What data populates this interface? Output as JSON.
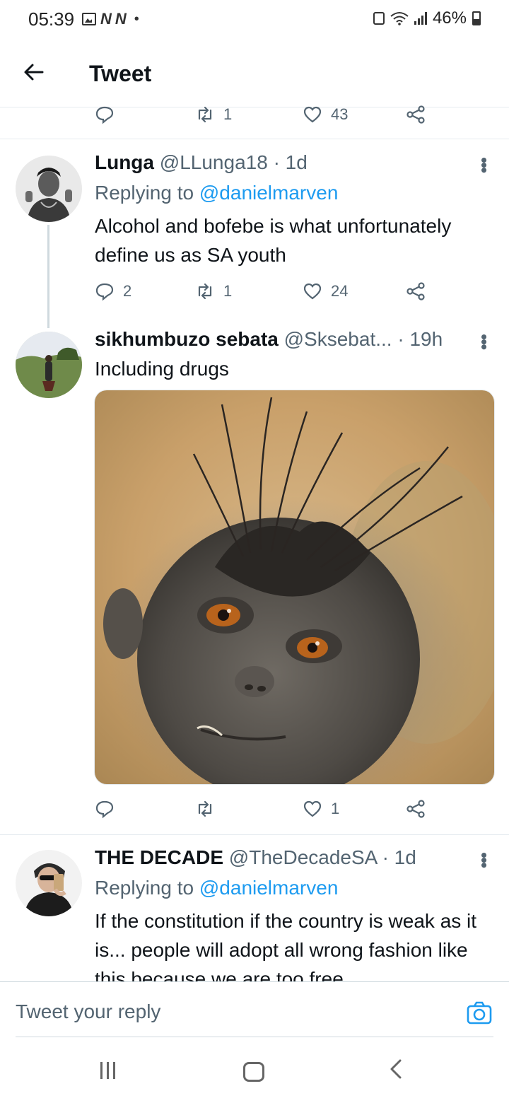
{
  "status_bar": {
    "time": "05:39",
    "battery": "46%",
    "notification_icons": [
      "image-icon",
      "n-icon",
      "n-icon"
    ]
  },
  "header": {
    "back_icon": "arrow-left-icon",
    "title": "Tweet"
  },
  "main_tweet_actions": {
    "retweets": "1",
    "likes": "43"
  },
  "replies": [
    {
      "name": "Lunga",
      "handle": "@LLunga18",
      "time": "· 1d",
      "replying_prefix": "Replying to",
      "replying_to": "@danielmarven",
      "text": "Alcohol and bofebe is what unfortunately define us as SA youth",
      "replies": "2",
      "retweets": "1",
      "likes": "24"
    },
    {
      "name": "sikhumbuzo sebata",
      "handle": "@Sksebat...",
      "time": "· 19h",
      "text": "Including drugs",
      "replies": "",
      "retweets": "",
      "likes": "1"
    },
    {
      "name": "THE DECADE",
      "handle": "@TheDecadeSA",
      "time": "· 1d",
      "replying_prefix": "Replying to",
      "replying_to": "@danielmarven",
      "text": "If the constitution if the country is weak as it is... people will adopt all wrong fashion like this because we are too free"
    }
  ],
  "reply_bar": {
    "placeholder": "Tweet your reply"
  },
  "colors": {
    "accent": "#1d9bf0",
    "muted": "#536471",
    "text": "#0f1419",
    "divider": "#e6ecf0"
  }
}
